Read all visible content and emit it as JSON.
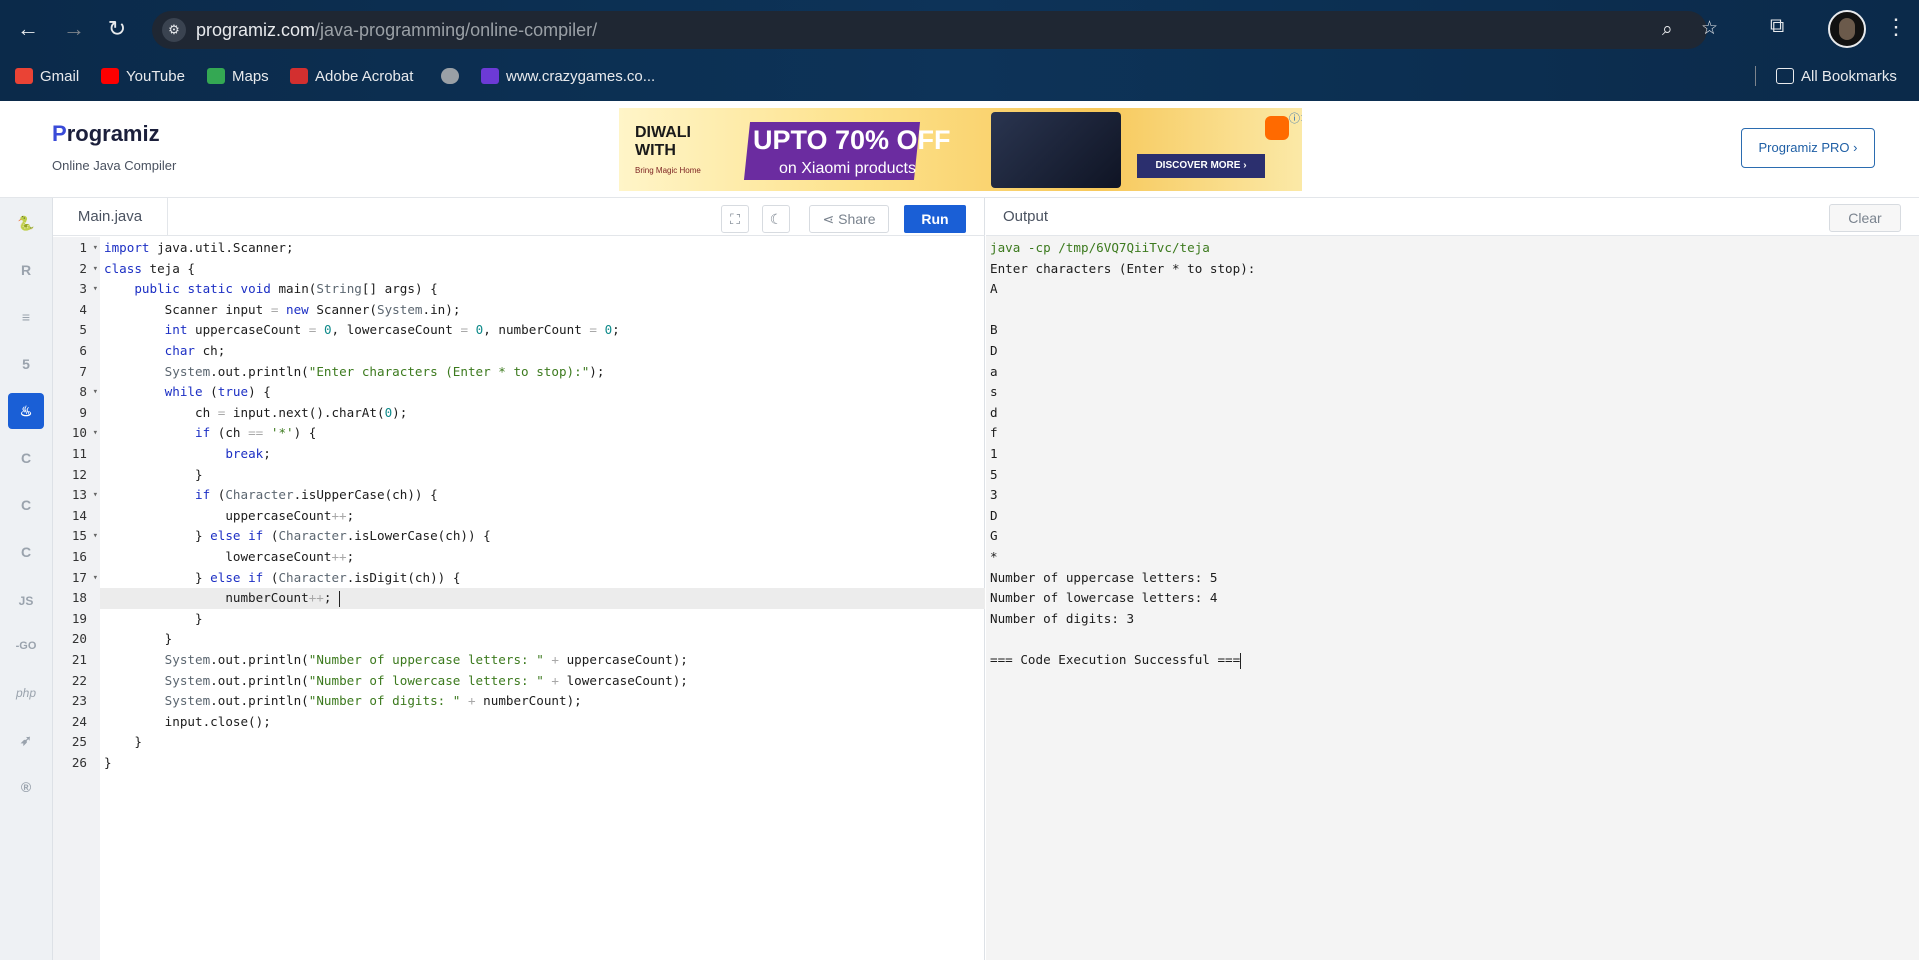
{
  "browser": {
    "url_domain": "programiz.com",
    "url_path": "/java-programming/online-compiler/",
    "bookmarks": [
      {
        "label": "Gmail",
        "color": "#ea4335"
      },
      {
        "label": "YouTube",
        "color": "#ff0000"
      },
      {
        "label": "Maps",
        "color": "#34a853"
      },
      {
        "label": "Adobe Acrobat",
        "color": "#d32f2f"
      },
      {
        "label": "",
        "color": "#9aa0a6"
      },
      {
        "label": "www.crazygames.co...",
        "color": "#6c3ad6"
      }
    ],
    "all_bookmarks_label": "All Bookmarks"
  },
  "site": {
    "logo_text": "rogramiz",
    "logo_initial": "P",
    "subtitle": "Online Java Compiler",
    "pro_button": "Programiz PRO ›",
    "ad": {
      "headline": "DIWALI WITH",
      "tagline": "Bring Magic Home",
      "offer": "UPTO 70% OFF",
      "sub": "on Xiaomi products",
      "cta": "DISCOVER MORE ›"
    }
  },
  "editor": {
    "file_tab": "Main.java",
    "share_label": "Share",
    "run_label": "Run",
    "active_line": 18
  },
  "output": {
    "title": "Output",
    "clear_label": "Clear",
    "lines": [
      "java -cp /tmp/6VQ7QiiTvc/teja",
      "Enter characters (Enter * to stop):",
      "A",
      "",
      "B",
      "D",
      "a",
      "s",
      "d",
      "f",
      "1",
      "5",
      "3",
      "D",
      "G",
      "*",
      "Number of uppercase letters: 5",
      "Number of lowercase letters: 4",
      "Number of digits: 3",
      "",
      "=== Code Execution Successful ==="
    ]
  }
}
